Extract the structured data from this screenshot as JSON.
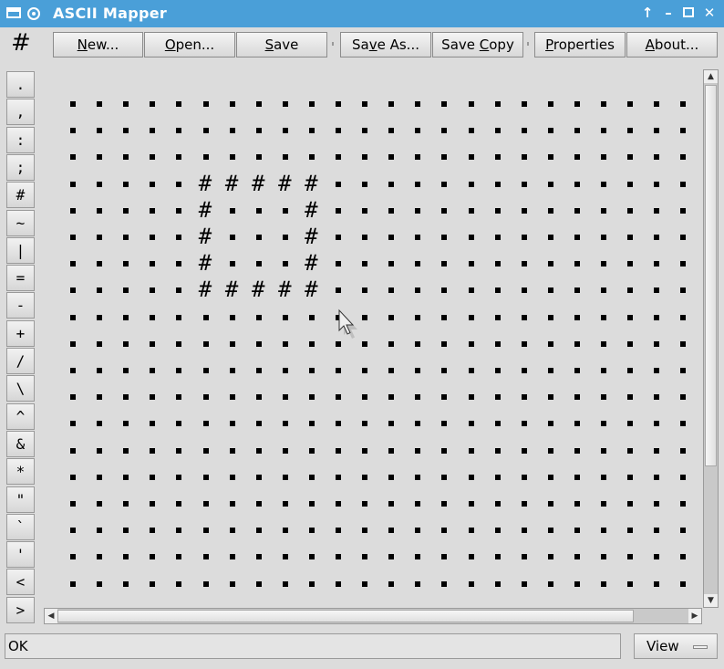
{
  "window": {
    "title": "ASCII Mapper"
  },
  "toolbar": {
    "current_symbol": "#",
    "new_label": "New...",
    "open_label": "Open...",
    "save_label": "Save",
    "save_as_label": "Save As...",
    "save_copy_label": "Save Copy",
    "properties_label": "Properties",
    "about_label": "About..."
  },
  "palette": [
    ".",
    ",",
    ":",
    ";",
    "#",
    "~",
    "|",
    "=",
    "-",
    "+",
    "/",
    "\\",
    "^",
    "&",
    "*",
    "\"",
    "`",
    "'",
    "<",
    ">"
  ],
  "map": {
    "background_char": ".",
    "rows": [
      ".........................",
      ".........................",
      ".........................",
      ".....#####...............",
      ".....#...#...............",
      ".....#...#...............",
      ".....#...#...............",
      ".....#####...............",
      ".........................",
      ".........................",
      ".........................",
      ".........................",
      ".........................",
      ".........................",
      ".........................",
      ".........................",
      ".........................",
      ".........................",
      "........................."
    ]
  },
  "status": {
    "text": "OK"
  },
  "view_button": {
    "label": "View"
  }
}
